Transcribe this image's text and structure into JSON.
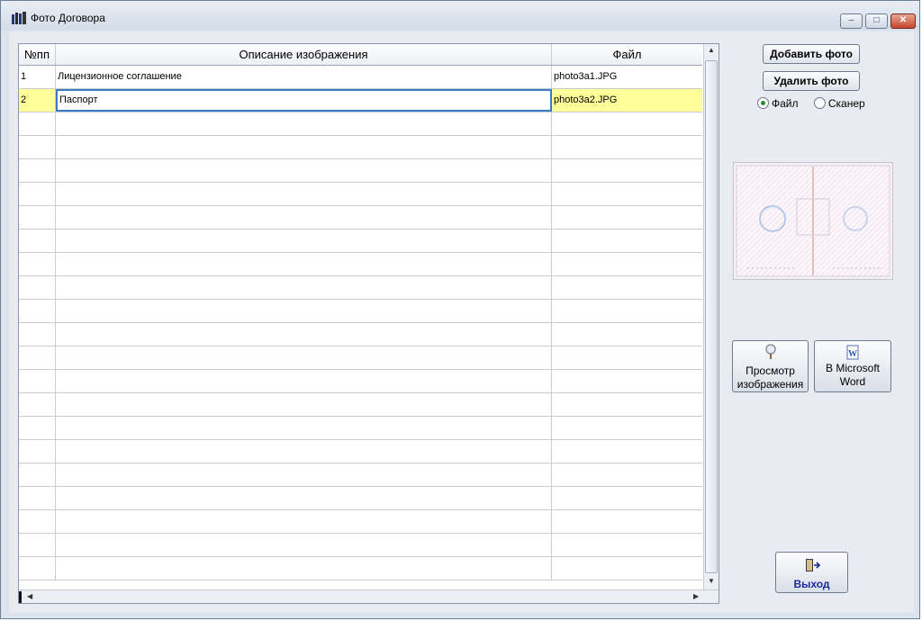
{
  "window": {
    "title": "Фото Договора",
    "controls": {
      "minimize": "–",
      "maximize": "□",
      "close": "✕"
    }
  },
  "grid": {
    "columns": [
      "№пп",
      "Описание изображения",
      "Файл"
    ],
    "rows": [
      {
        "num": "1",
        "desc": "Лицензионное соглашение",
        "file": "photo3a1.JPG",
        "selected": false
      },
      {
        "num": "2",
        "desc": "Паспорт",
        "file": "photo3a2.JPG",
        "selected": true
      }
    ],
    "empty_rows": 20
  },
  "buttons": {
    "add_photo": "Добавить фото",
    "delete_photo": "Удалить фото",
    "view_line1": "Просмотр",
    "view_line2": "изображения",
    "word_line1": "В Microsoft",
    "word_line2": "Word",
    "exit": "Выход"
  },
  "source": {
    "options": [
      "Файл",
      "Сканер"
    ],
    "selected": "Файл"
  },
  "icons": {
    "app": "books-icon",
    "view": "magnifier-icon",
    "word": "word-document-icon",
    "exit": "exit-door-icon"
  },
  "colors": {
    "selected_row": "#ffff99",
    "edit_border": "#3b7bc4",
    "exit_text": "#1a2a9a",
    "radio_dot": "#2b8a2b"
  }
}
